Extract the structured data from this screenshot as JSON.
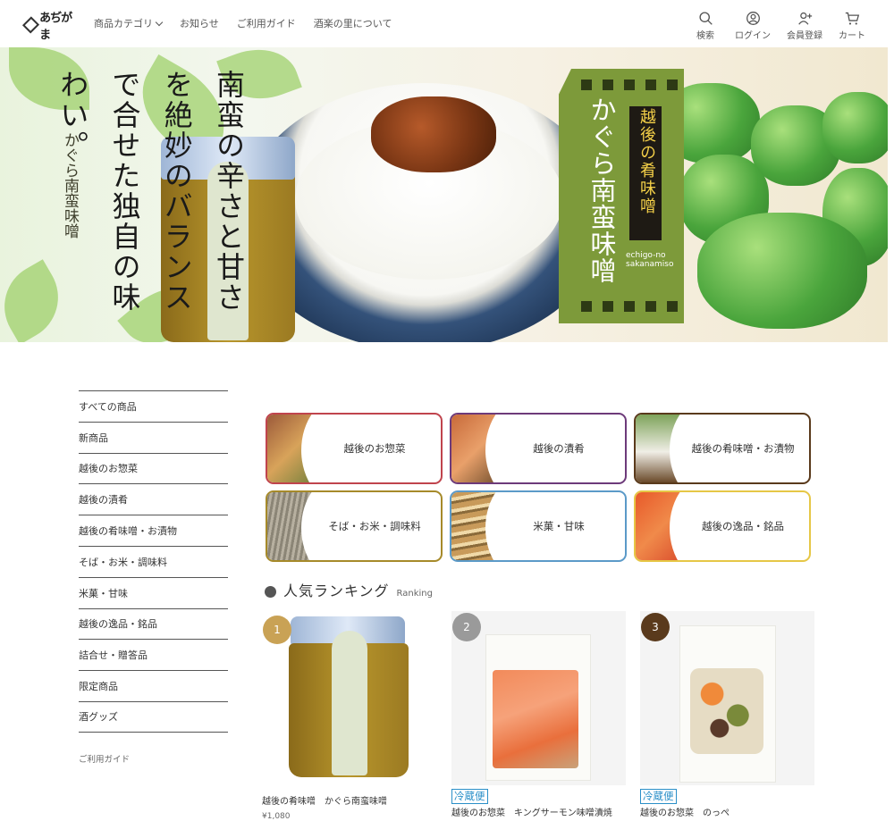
{
  "header": {
    "logo_text": "あぢがま",
    "nav": {
      "categories_label": "商品カテゴリ",
      "news_label": "お知らせ",
      "guide_label": "ご利用ガイド",
      "about_label": "酒楽の里について"
    },
    "icons": {
      "search_label": "検索",
      "login_label": "ログイン",
      "signup_label": "会員登録",
      "cart_label": "カート"
    }
  },
  "hero": {
    "copy": "南蛮の辛さと甘さを絶妙のバランスで合せた独自の味わい。",
    "product_title": "かぐら南蛮味噌",
    "product_subtitle": "越後の肴味噌",
    "product_roman": "echigo-no sakanamiso",
    "jar_label": "かぐら南蛮味噌",
    "slides": [
      {
        "active": true
      },
      {
        "active": false
      }
    ]
  },
  "sidebar": {
    "items": [
      "すべての商品",
      "新商品",
      "越後のお惣菜",
      "越後の漬肴",
      "越後の肴味噌・お漬物",
      "そば・お米・調味料",
      "米菓・甘味",
      "越後の逸品・銘品",
      "詰合せ・贈答品",
      "限定商品",
      "酒グッズ"
    ],
    "guide_label": "ご利用ガイド"
  },
  "categories": [
    {
      "label": "越後のお惣菜",
      "color": "#c0444d"
    },
    {
      "label": "越後の漬肴",
      "color": "#6d3a7a"
    },
    {
      "label": "越後の肴味噌・お漬物",
      "color": "#5a3a1c"
    },
    {
      "label": "そば・お米・調味料",
      "color": "#a68a2a"
    },
    {
      "label": "米菓・甘味",
      "color": "#5b9ac8"
    },
    {
      "label": "越後の逸品・銘品",
      "color": "#e6c746"
    }
  ],
  "ranking": {
    "title": "人気ランキング",
    "subtitle": "Ranking",
    "items": [
      {
        "rank": "1",
        "badge_color": "#c9a255",
        "tag": "",
        "name": "越後の肴味噌　かぐら南蛮味噌",
        "price": "¥1,080"
      },
      {
        "rank": "2",
        "badge_color": "#9a9a9a",
        "tag": "冷蔵便",
        "name": "越後のお惣菜　キングサーモン味噌漬焼",
        "price": ""
      },
      {
        "rank": "3",
        "badge_color": "#5a3a1c",
        "tag": "冷蔵便",
        "name": "越後のお惣菜　のっぺ",
        "price": ""
      }
    ]
  }
}
